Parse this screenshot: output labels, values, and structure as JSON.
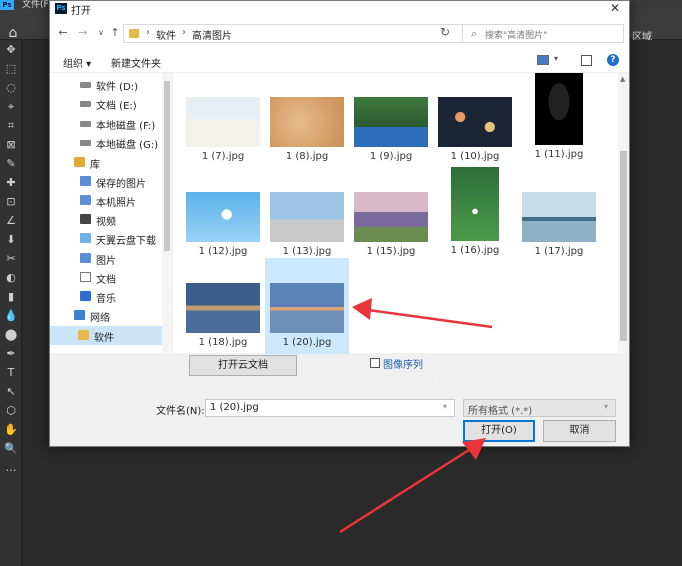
{
  "ps": {
    "menu_text": "文件(F)",
    "region_text": "区域",
    "tools": [
      "✥",
      "⬚",
      "◌",
      "⌖",
      "⌗",
      "⊠",
      "✎",
      "✚",
      "⊡",
      "∠",
      "⬇",
      "✂",
      "◐",
      "▮",
      "💧",
      "⬤",
      "✒",
      "T",
      "↖",
      "⬡",
      "✋",
      "🔍",
      "…"
    ]
  },
  "dialog": {
    "title": "打开",
    "close": "✕",
    "nav": {
      "back": "←",
      "forward": "→",
      "dropdown": "∨",
      "up": "↑",
      "breadcrumb": [
        "软件",
        "高清图片"
      ],
      "refresh": "↻",
      "search_placeholder": "搜索\"高清图片\""
    },
    "commands": {
      "organize": "组织 ▾",
      "new_folder": "新建文件夹",
      "help": "?"
    },
    "sidebar": [
      {
        "label": "软件 (D:)",
        "icon": "drive-icon"
      },
      {
        "label": "文档 (E:)",
        "icon": "drive-icon"
      },
      {
        "label": "本地磁盘 (F:)",
        "icon": "drive-icon"
      },
      {
        "label": "本地磁盘 (G:)",
        "icon": "drive-icon"
      },
      {
        "label": "库",
        "icon": "library-icon"
      },
      {
        "label": "保存的图片",
        "icon": "pictures-icon"
      },
      {
        "label": "本机照片",
        "icon": "pictures-icon"
      },
      {
        "label": "视频",
        "icon": "video-icon"
      },
      {
        "label": "天翼云盘下载",
        "icon": "cloud-icon"
      },
      {
        "label": "图片",
        "icon": "pictures-icon"
      },
      {
        "label": "文档",
        "icon": "document-icon"
      },
      {
        "label": "音乐",
        "icon": "music-icon"
      },
      {
        "label": "网络",
        "icon": "network-icon"
      },
      {
        "label": "软件",
        "icon": "folder-icon",
        "selected": true
      }
    ],
    "files": [
      {
        "name": "1 (7).jpg"
      },
      {
        "name": "1 (8).jpg"
      },
      {
        "name": "1 (9).jpg"
      },
      {
        "name": "1 (10).jpg"
      },
      {
        "name": "1 (11).jpg"
      },
      {
        "name": "1 (12).jpg"
      },
      {
        "name": "1 (13).jpg"
      },
      {
        "name": "1 (15).jpg"
      },
      {
        "name": "1 (16).jpg"
      },
      {
        "name": "1 (17).jpg"
      },
      {
        "name": "1 (18).jpg"
      },
      {
        "name": "1 (20).jpg",
        "selected": true
      }
    ],
    "cloud_button": "打开云文档",
    "image_sequence_label": "图像序列",
    "image_sequence_checked": false,
    "filename_label": "文件名(N):",
    "filename_value": "1 (20).jpg",
    "format_value": "所有格式 (*.*)",
    "open_button": "打开(O)",
    "cancel_button": "取消"
  },
  "colors": {
    "accent": "#0078d7",
    "selection": "#cce8ff",
    "arrow": "#e8343a"
  }
}
